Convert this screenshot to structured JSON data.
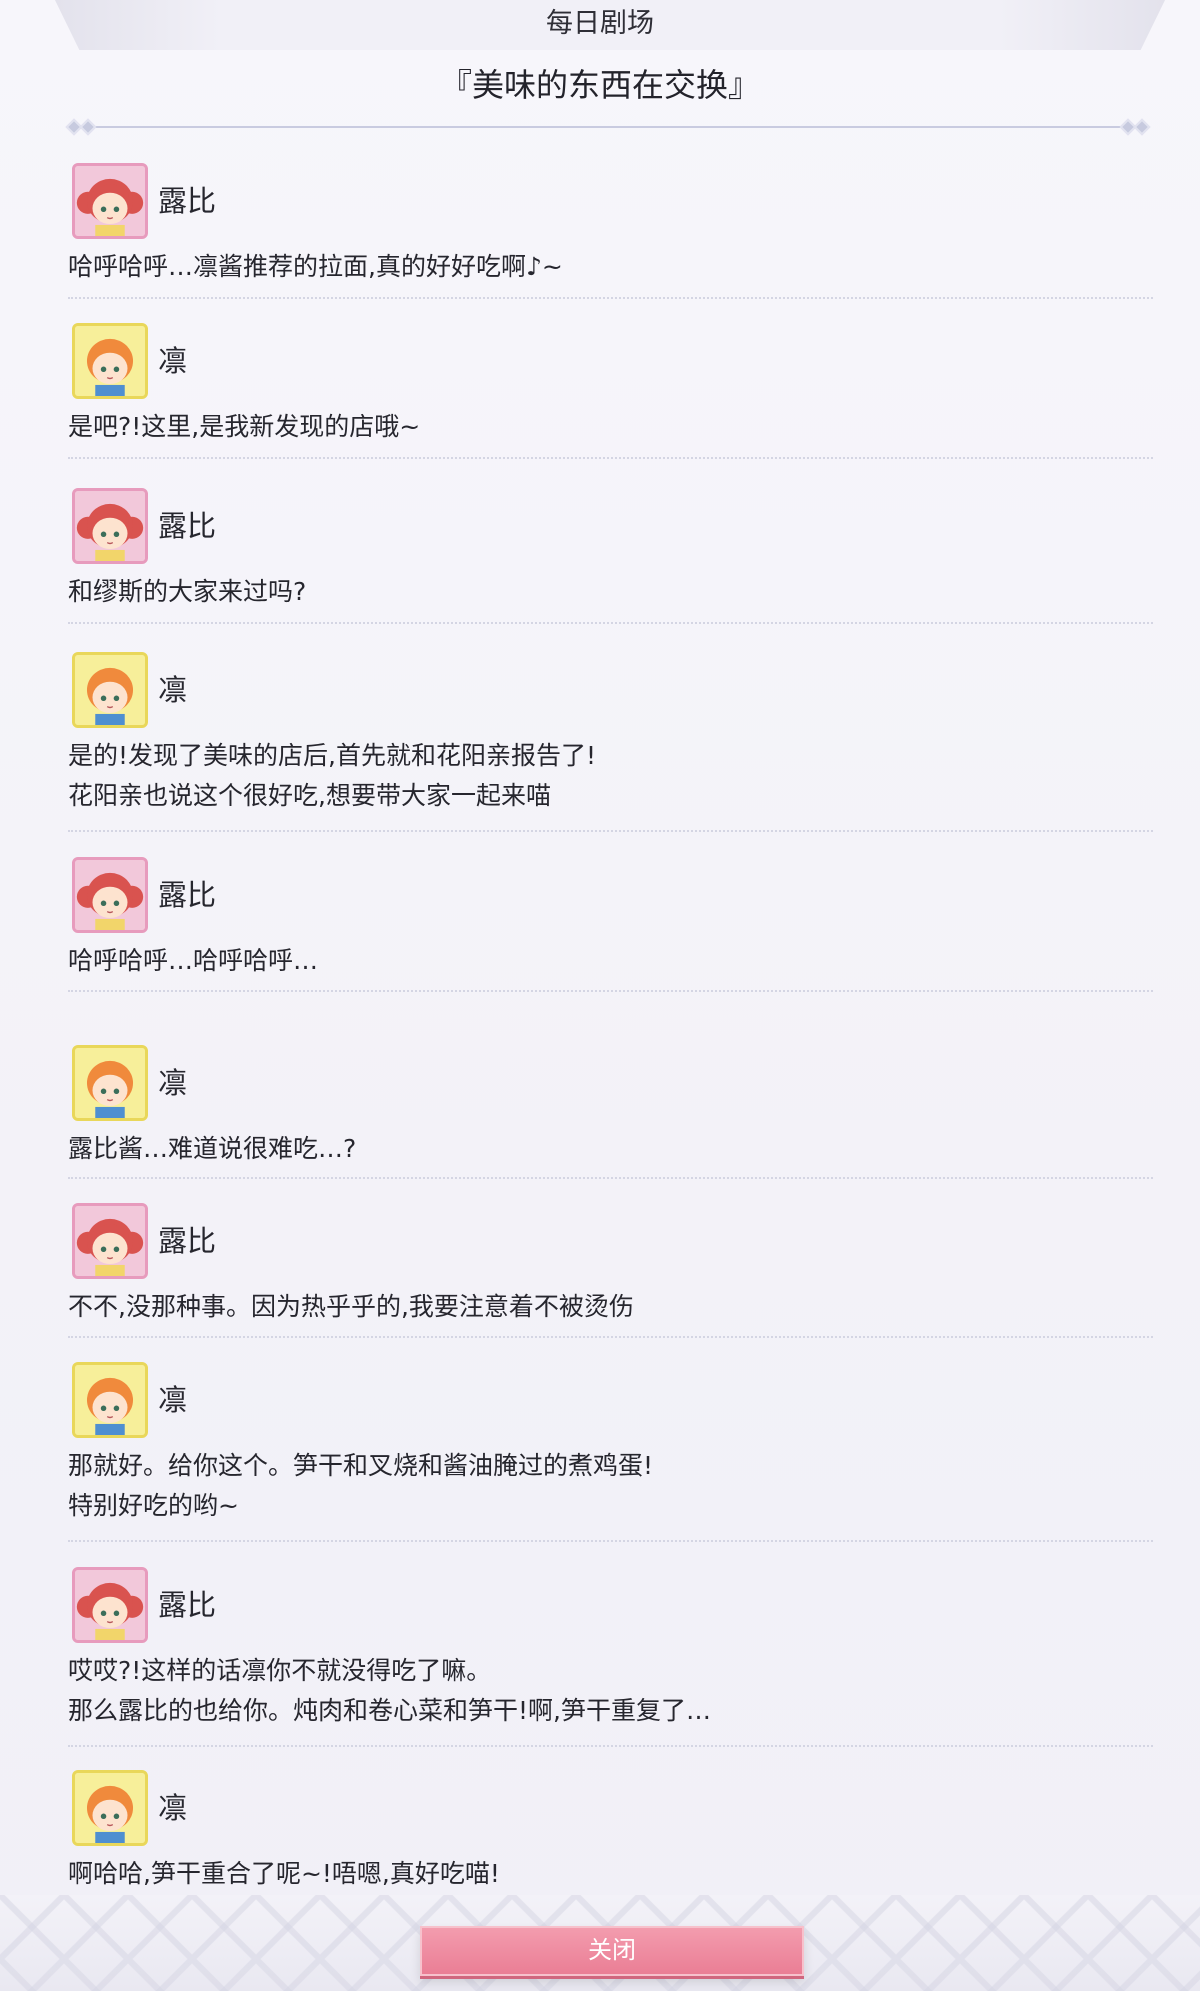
{
  "header": {
    "title": "每日剧场",
    "subtitle": "『美味的东西在交换』"
  },
  "speakers": {
    "ruby": {
      "name": "露比",
      "avatar_color": "#f2c8da",
      "hair_color": "#d9534f"
    },
    "rin": {
      "name": "凛",
      "avatar_color": "#f7ef9a",
      "hair_color": "#f08a3c"
    }
  },
  "dialog": [
    {
      "speaker": "露比",
      "avatar": "ruby",
      "lines": [
        "哈呼哈呼…凛酱推荐的拉面,真的好好吃啊♪~"
      ]
    },
    {
      "speaker": "凛",
      "avatar": "rin",
      "lines": [
        "是吧?!这里,是我新发现的店哦~"
      ]
    },
    {
      "speaker": "露比",
      "avatar": "ruby",
      "lines": [
        "和缪斯的大家来过吗?"
      ]
    },
    {
      "speaker": "凛",
      "avatar": "rin",
      "lines": [
        "是的!发现了美味的店后,首先就和花阳亲报告了!",
        "花阳亲也说这个很好吃,想要带大家一起来喵"
      ]
    },
    {
      "speaker": "露比",
      "avatar": "ruby",
      "lines": [
        "哈呼哈呼…哈呼哈呼…"
      ]
    },
    {
      "speaker": "凛",
      "avatar": "rin",
      "lines": [
        "露比酱…难道说很难吃…?"
      ]
    },
    {
      "speaker": "露比",
      "avatar": "ruby",
      "lines": [
        "不不,没那种事。因为热乎乎的,我要注意着不被烫伤"
      ]
    },
    {
      "speaker": "凛",
      "avatar": "rin",
      "lines": [
        "那就好。给你这个。笋干和叉烧和酱油腌过的煮鸡蛋!",
        "特别好吃的哟~"
      ]
    },
    {
      "speaker": "露比",
      "avatar": "ruby",
      "lines": [
        "哎哎?!这样的话凛你不就没得吃了嘛。",
        "那么露比的也给你。炖肉和卷心菜和笋干!啊,笋干重复了…"
      ]
    },
    {
      "speaker": "凛",
      "avatar": "rin",
      "lines": [
        "啊哈哈,笋干重合了呢~!唔嗯,真好吃喵!"
      ]
    }
  ],
  "footer": {
    "close_label": "关闭",
    "button_color": "#ea7e95"
  }
}
